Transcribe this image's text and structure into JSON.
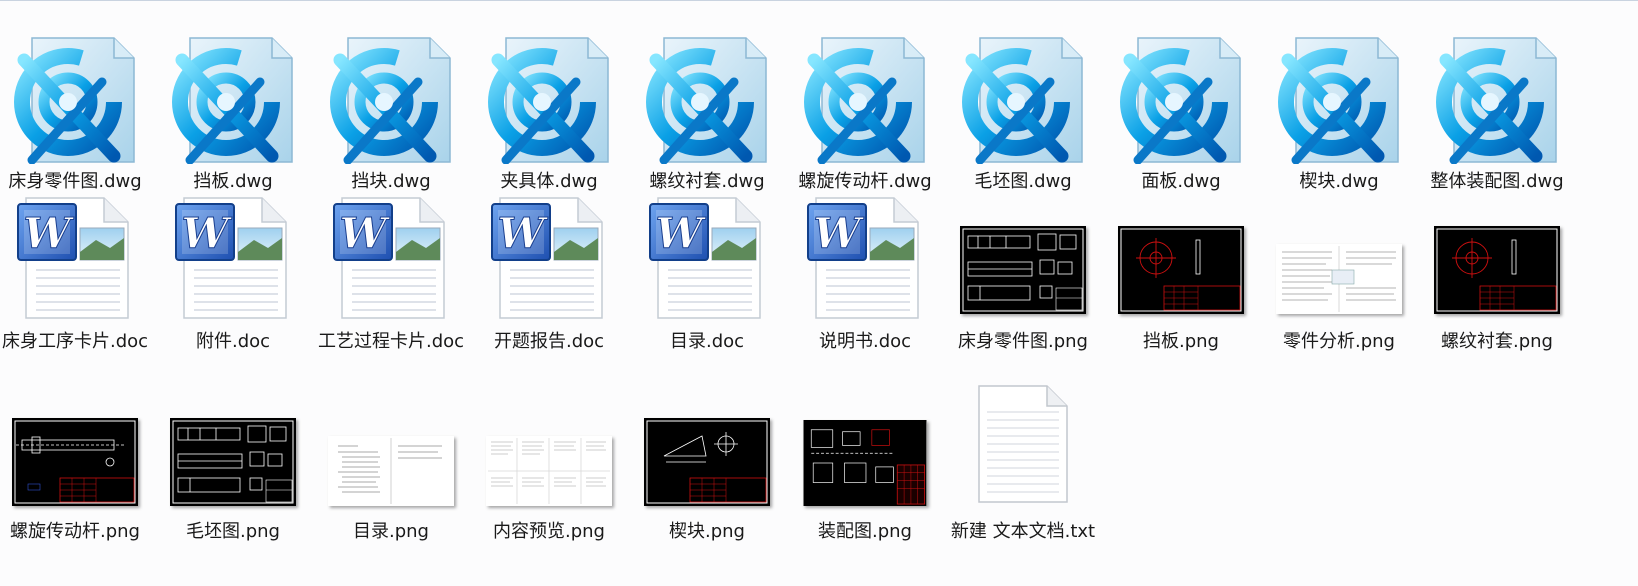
{
  "files": {
    "row1": [
      {
        "name": "床身零件图.dwg",
        "icon": "dwg-file-icon"
      },
      {
        "name": "挡板.dwg",
        "icon": "dwg-file-icon"
      },
      {
        "name": "挡块.dwg",
        "icon": "dwg-file-icon"
      },
      {
        "name": "夹具体.dwg",
        "icon": "dwg-file-icon"
      },
      {
        "name": "螺纹衬套.dwg",
        "icon": "dwg-file-icon"
      },
      {
        "name": "螺旋传动杆.dwg",
        "icon": "dwg-file-icon"
      },
      {
        "name": "毛坯图.dwg",
        "icon": "dwg-file-icon"
      },
      {
        "name": "面板.dwg",
        "icon": "dwg-file-icon"
      },
      {
        "name": "楔块.dwg",
        "icon": "dwg-file-icon"
      },
      {
        "name": "整体装配图.dwg",
        "icon": "dwg-file-icon"
      }
    ],
    "row2": [
      {
        "name": "床身工序卡片.doc",
        "icon": "word-doc-icon"
      },
      {
        "name": "附件.doc",
        "icon": "word-doc-icon"
      },
      {
        "name": "工艺过程卡片.doc",
        "icon": "word-doc-icon"
      },
      {
        "name": "开题报告.doc",
        "icon": "word-doc-icon"
      },
      {
        "name": "目录.doc",
        "icon": "word-doc-icon"
      },
      {
        "name": "说明书.doc",
        "icon": "word-doc-icon"
      },
      {
        "name": "床身零件图.png",
        "icon": "cad-drawing-thumbnail"
      },
      {
        "name": "挡板.png",
        "icon": "cad-drawing-thumbnail"
      },
      {
        "name": "零件分析.png",
        "icon": "document-page-thumbnail"
      },
      {
        "name": "螺纹衬套.png",
        "icon": "cad-drawing-thumbnail"
      }
    ],
    "row3": [
      {
        "name": "螺旋传动杆.png",
        "icon": "cad-drawing-thumbnail"
      },
      {
        "name": "毛坯图.png",
        "icon": "cad-drawing-thumbnail"
      },
      {
        "name": "目录.png",
        "icon": "document-page-thumbnail"
      },
      {
        "name": "内容预览.png",
        "icon": "document-page-thumbnail"
      },
      {
        "name": "楔块.png",
        "icon": "cad-drawing-thumbnail"
      },
      {
        "name": "装配图.png",
        "icon": "cad-drawing-thumbnail"
      },
      {
        "name": "新建 文本文档.txt",
        "icon": "text-file-icon"
      }
    ]
  },
  "colors": {
    "background": "#fcfcfd",
    "label_text": "#1a1a1a",
    "dwg_accent": "#0aa0e6",
    "word_blue": "#2a5fc4",
    "cad_background": "#000000",
    "cad_titleblock": "#d01010"
  }
}
